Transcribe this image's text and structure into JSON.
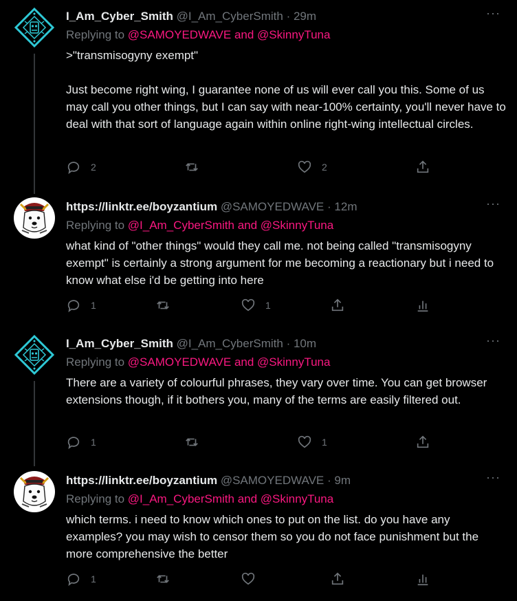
{
  "tweets": [
    {
      "name": "I_Am_Cyber_Smith",
      "handle": "@I_Am_CyberSmith",
      "sep": "·",
      "time": "29m",
      "replying_prefix": "Replying to ",
      "mention1": "@SAMOYEDWAVE",
      "and": " and ",
      "mention2": "@SkinnyTuna",
      "text": ">\"transmisogyny exempt\"\n\nJust become right wing, I guarantee none of us will ever call you this. Some of us may call you other things, but I can say with near-100% certainty, you'll never have to deal with that sort of language again within online right-wing intellectual circles.",
      "replies": "2",
      "retweets": "",
      "likes": "2",
      "avatar_icon": "cyber-emblem-icon"
    },
    {
      "name": "https://linktr.ee/boyzantium",
      "handle": "@SAMOYEDWAVE",
      "sep": "·",
      "time": "12m",
      "replying_prefix": "Replying to ",
      "mention1": "@I_Am_CyberSmith",
      "and": " and ",
      "mention2": "@SkinnyTuna",
      "text": "what kind of \"other things\" would they call me. not being called \"transmisogyny exempt\" is certainly a strong argument for me becoming a reactionary but i need to know what else i'd be getting into here",
      "replies": "1",
      "retweets": "",
      "likes": "1",
      "avatar_icon": "samoyed-samurai-icon"
    },
    {
      "name": "I_Am_Cyber_Smith",
      "handle": "@I_Am_CyberSmith",
      "sep": "·",
      "time": "10m",
      "replying_prefix": "Replying to ",
      "mention1": "@SAMOYEDWAVE",
      "and": " and ",
      "mention2": "@SkinnyTuna",
      "text": "There are a variety of colourful phrases, they vary over time. You can get browser extensions though, if it bothers you, many of the terms are easily filtered out.",
      "replies": "1",
      "retweets": "",
      "likes": "1",
      "avatar_icon": "cyber-emblem-icon"
    },
    {
      "name": "https://linktr.ee/boyzantium",
      "handle": "@SAMOYEDWAVE",
      "sep": "·",
      "time": "9m",
      "replying_prefix": "Replying to ",
      "mention1": "@I_Am_CyberSmith",
      "and": " and ",
      "mention2": "@SkinnyTuna",
      "text": "which terms. i need to know which ones to put on the list. do you have any examples? you may wish to censor them so you do not face punishment but the more comprehensive the better",
      "replies": "1",
      "retweets": "",
      "likes": "",
      "avatar_icon": "samoyed-samurai-icon"
    }
  ],
  "colors": {
    "background": "#000000",
    "text": "#e7e9ea",
    "muted": "#71767b",
    "mention": "#f91880",
    "cyber_accent": "#2ec9d6"
  }
}
